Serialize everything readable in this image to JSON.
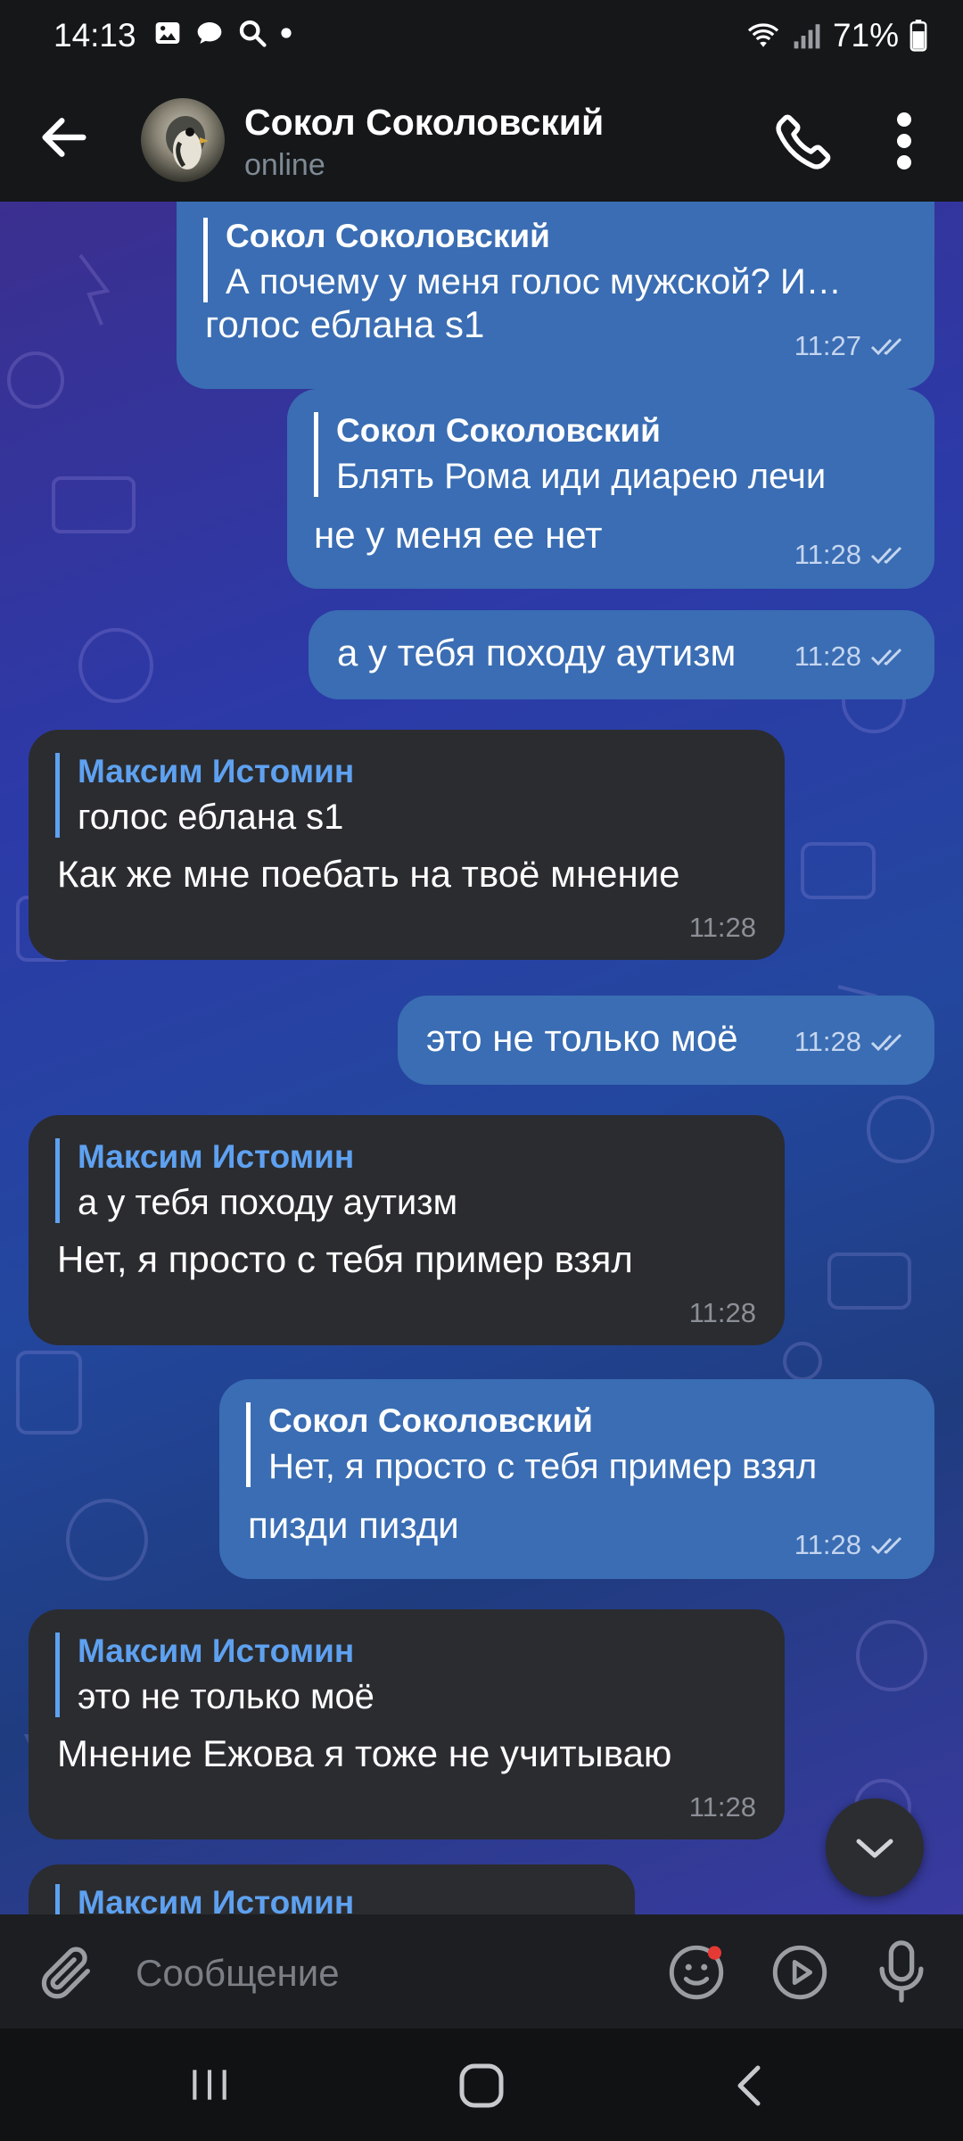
{
  "status_bar": {
    "time": "14:13",
    "battery": "71%"
  },
  "header": {
    "title": "Сокол Соколовский",
    "status": "online"
  },
  "messages": [
    {
      "type": "outgoing",
      "reply_name": "Сокол Соколовский",
      "reply_text": "А почему у меня голос мужской? И…",
      "text": "голос еблана s1",
      "time": "11:27"
    },
    {
      "type": "outgoing",
      "reply_name": "Сокол Соколовский",
      "reply_text": "Блять Рома иди диарею лечи",
      "text": "не у меня ее нет",
      "time": "11:28"
    },
    {
      "type": "outgoing",
      "text": "а у тебя походу аутизм",
      "time": "11:28"
    },
    {
      "type": "incoming",
      "reply_name": "Максим Истомин",
      "reply_text": "голос еблана s1",
      "text": "Как же мне поебать на твоё мнение",
      "time": "11:28"
    },
    {
      "type": "outgoing",
      "text": "это не только моё",
      "time": "11:28"
    },
    {
      "type": "incoming",
      "reply_name": "Максим Истомин",
      "reply_text": "а у тебя походу аутизм",
      "text": "Нет, я просто с тебя пример взял",
      "time": "11:28"
    },
    {
      "type": "outgoing",
      "reply_name": "Сокол Соколовский",
      "reply_text": "Нет, я просто с тебя пример взял",
      "text": "пизди пизди",
      "time": "11:28"
    },
    {
      "type": "incoming",
      "reply_name": "Максим Истомин",
      "reply_text": "это не только моё",
      "text": "Мнение Ежова я тоже не учитываю",
      "time": "11:28"
    },
    {
      "type": "incoming",
      "reply_name": "Максим Истомин"
    }
  ],
  "input": {
    "placeholder": "Сообщение"
  },
  "colors": {
    "outgoing_bubble": "#3a6db3",
    "incoming_bubble": "#2b2c30",
    "accent": "#5ea1f0",
    "unread_dot": "#e53935"
  }
}
